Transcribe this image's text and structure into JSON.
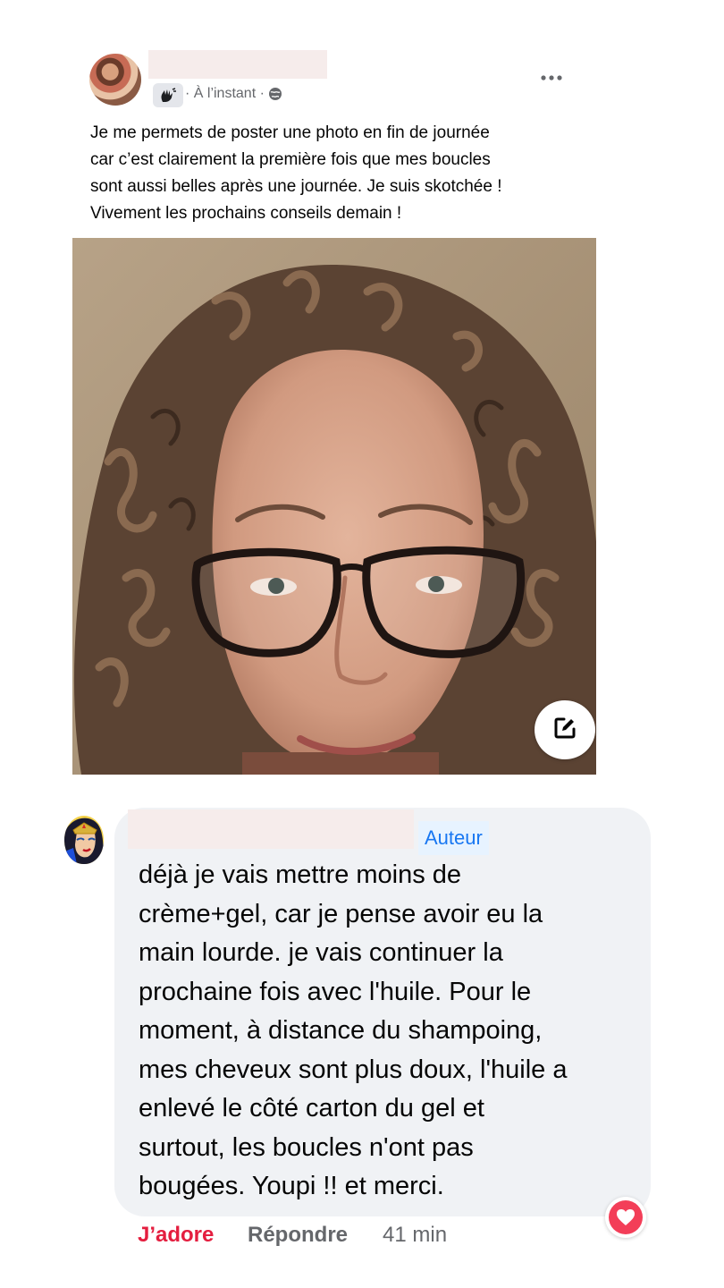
{
  "post": {
    "meta_time": "· À l’instant ·",
    "icons": {
      "group": "group-icon",
      "audience": "globe-icon",
      "menu": "more-options-icon"
    },
    "text_lines": [
      "Je me permets de poster une photo en fin de journée",
      "car c’est clairement la première fois que mes boucles",
      "sont aussi belles après une journée. Je suis skotchée !",
      "Vivement les prochains conseils demain !"
    ],
    "photo_edit_icon": "edit-icon"
  },
  "comment": {
    "author_badge": "Auteur",
    "text_lines": [
      "déjà je vais mettre moins de",
      "crème+gel, car je pense avoir eu la",
      "main lourde. je vais continuer la",
      "prochaine fois avec l'huile. Pour le",
      "moment, à distance du shampoing,",
      "mes cheveux sont plus doux, l'huile a",
      "enlevé le côté carton du gel et",
      "surtout, les boucles n'ont pas",
      "bougées. Youpi !! et merci."
    ],
    "reaction_icon": "heart-reaction-icon",
    "actions": {
      "like": "J’adore",
      "reply": "Répondre",
      "time": "41 min"
    }
  },
  "colors": {
    "like_red": "#e41e3f",
    "link_blue": "#1877f2",
    "bubble_gray": "#f0f2f5",
    "meta_gray": "#65676b"
  }
}
